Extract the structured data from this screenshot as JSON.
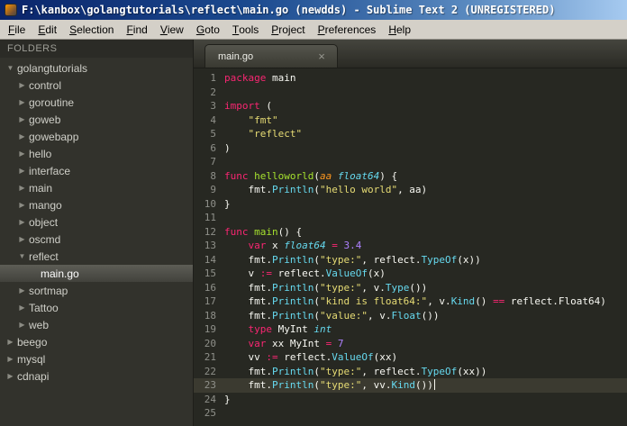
{
  "titlebar": {
    "title": "F:\\kanbox\\golangtutorials\\reflect\\main.go (newdds) - Sublime Text 2 (UNREGISTERED)"
  },
  "menubar": {
    "items": [
      "File",
      "Edit",
      "Selection",
      "Find",
      "View",
      "Goto",
      "Tools",
      "Project",
      "Preferences",
      "Help"
    ]
  },
  "icons": {
    "expanded": "▼",
    "collapsed": "▶",
    "close": "×"
  },
  "sidebar": {
    "header": "FOLDERS",
    "items": [
      {
        "label": "golangtutorials",
        "level": 0,
        "kind": "folder",
        "state": "expanded",
        "selected": false
      },
      {
        "label": "control",
        "level": 1,
        "kind": "folder",
        "state": "collapsed",
        "selected": false
      },
      {
        "label": "goroutine",
        "level": 1,
        "kind": "folder",
        "state": "collapsed",
        "selected": false
      },
      {
        "label": "goweb",
        "level": 1,
        "kind": "folder",
        "state": "collapsed",
        "selected": false
      },
      {
        "label": "gowebapp",
        "level": 1,
        "kind": "folder",
        "state": "collapsed",
        "selected": false
      },
      {
        "label": "hello",
        "level": 1,
        "kind": "folder",
        "state": "collapsed",
        "selected": false
      },
      {
        "label": "interface",
        "level": 1,
        "kind": "folder",
        "state": "collapsed",
        "selected": false
      },
      {
        "label": "main",
        "level": 1,
        "kind": "folder",
        "state": "collapsed",
        "selected": false
      },
      {
        "label": "mango",
        "level": 1,
        "kind": "folder",
        "state": "collapsed",
        "selected": false
      },
      {
        "label": "object",
        "level": 1,
        "kind": "folder",
        "state": "collapsed",
        "selected": false
      },
      {
        "label": "oscmd",
        "level": 1,
        "kind": "folder",
        "state": "collapsed",
        "selected": false
      },
      {
        "label": "reflect",
        "level": 1,
        "kind": "folder",
        "state": "expanded",
        "selected": false
      },
      {
        "label": "main.go",
        "level": 2,
        "kind": "file",
        "state": "none",
        "selected": true
      },
      {
        "label": "sortmap",
        "level": 1,
        "kind": "folder",
        "state": "collapsed",
        "selected": false
      },
      {
        "label": "Tattoo",
        "level": 1,
        "kind": "folder",
        "state": "collapsed",
        "selected": false
      },
      {
        "label": "web",
        "level": 1,
        "kind": "folder",
        "state": "collapsed",
        "selected": false
      },
      {
        "label": "beego",
        "level": 0,
        "kind": "folder",
        "state": "collapsed",
        "selected": false
      },
      {
        "label": "mysql",
        "level": 0,
        "kind": "folder",
        "state": "collapsed",
        "selected": false
      },
      {
        "label": "cdnapi",
        "level": 0,
        "kind": "folder",
        "state": "collapsed",
        "selected": false
      }
    ]
  },
  "editor": {
    "tab": {
      "label": "main.go"
    },
    "current_line": 23,
    "lines": [
      {
        "n": 1,
        "tokens": [
          [
            "k",
            "package"
          ],
          [
            "p",
            " main"
          ]
        ]
      },
      {
        "n": 2,
        "tokens": []
      },
      {
        "n": 3,
        "tokens": [
          [
            "k",
            "import"
          ],
          [
            "p",
            " ("
          ]
        ]
      },
      {
        "n": 4,
        "tokens": [
          [
            "p",
            "    "
          ],
          [
            "s",
            "\"fmt\""
          ]
        ]
      },
      {
        "n": 5,
        "tokens": [
          [
            "p",
            "    "
          ],
          [
            "s",
            "\"reflect\""
          ]
        ]
      },
      {
        "n": 6,
        "tokens": [
          [
            "p",
            ")"
          ]
        ]
      },
      {
        "n": 7,
        "tokens": []
      },
      {
        "n": 8,
        "tokens": [
          [
            "k",
            "func"
          ],
          [
            "p",
            " "
          ],
          [
            "fn",
            "helloworld"
          ],
          [
            "p",
            "("
          ],
          [
            "a",
            "aa"
          ],
          [
            "p",
            " "
          ],
          [
            "t",
            "float64"
          ],
          [
            "p",
            ") {"
          ]
        ]
      },
      {
        "n": 9,
        "tokens": [
          [
            "p",
            "    fmt."
          ],
          [
            "c",
            "Println"
          ],
          [
            "p",
            "("
          ],
          [
            "s",
            "\"hello world\""
          ],
          [
            "p",
            ", aa)"
          ]
        ]
      },
      {
        "n": 10,
        "tokens": [
          [
            "p",
            "}"
          ]
        ]
      },
      {
        "n": 11,
        "tokens": []
      },
      {
        "n": 12,
        "tokens": [
          [
            "k",
            "func"
          ],
          [
            "p",
            " "
          ],
          [
            "fn",
            "main"
          ],
          [
            "p",
            "() {"
          ]
        ]
      },
      {
        "n": 13,
        "tokens": [
          [
            "p",
            "    "
          ],
          [
            "k",
            "var"
          ],
          [
            "p",
            " x "
          ],
          [
            "t",
            "float64"
          ],
          [
            "p",
            " "
          ],
          [
            "o",
            "="
          ],
          [
            "p",
            " "
          ],
          [
            "n",
            "3.4"
          ]
        ]
      },
      {
        "n": 14,
        "tokens": [
          [
            "p",
            "    fmt."
          ],
          [
            "c",
            "Println"
          ],
          [
            "p",
            "("
          ],
          [
            "s",
            "\"type:\""
          ],
          [
            "p",
            ", reflect."
          ],
          [
            "c",
            "TypeOf"
          ],
          [
            "p",
            "(x))"
          ]
        ]
      },
      {
        "n": 15,
        "tokens": [
          [
            "p",
            "    v "
          ],
          [
            "o",
            ":="
          ],
          [
            "p",
            " reflect."
          ],
          [
            "c",
            "ValueOf"
          ],
          [
            "p",
            "(x)"
          ]
        ]
      },
      {
        "n": 16,
        "tokens": [
          [
            "p",
            "    fmt."
          ],
          [
            "c",
            "Println"
          ],
          [
            "p",
            "("
          ],
          [
            "s",
            "\"type:\""
          ],
          [
            "p",
            ", v."
          ],
          [
            "c",
            "Type"
          ],
          [
            "p",
            "())"
          ]
        ]
      },
      {
        "n": 17,
        "tokens": [
          [
            "p",
            "    fmt."
          ],
          [
            "c",
            "Println"
          ],
          [
            "p",
            "("
          ],
          [
            "s",
            "\"kind is float64:\""
          ],
          [
            "p",
            ", v."
          ],
          [
            "c",
            "Kind"
          ],
          [
            "p",
            "() "
          ],
          [
            "o",
            "=="
          ],
          [
            "p",
            " reflect.Float64)"
          ]
        ]
      },
      {
        "n": 18,
        "tokens": [
          [
            "p",
            "    fmt."
          ],
          [
            "c",
            "Println"
          ],
          [
            "p",
            "("
          ],
          [
            "s",
            "\"value:\""
          ],
          [
            "p",
            ", v."
          ],
          [
            "c",
            "Float"
          ],
          [
            "p",
            "())"
          ]
        ]
      },
      {
        "n": 19,
        "tokens": [
          [
            "p",
            "    "
          ],
          [
            "k",
            "type"
          ],
          [
            "p",
            " MyInt "
          ],
          [
            "t",
            "int"
          ]
        ]
      },
      {
        "n": 20,
        "tokens": [
          [
            "p",
            "    "
          ],
          [
            "k",
            "var"
          ],
          [
            "p",
            " xx MyInt "
          ],
          [
            "o",
            "="
          ],
          [
            "p",
            " "
          ],
          [
            "n",
            "7"
          ]
        ]
      },
      {
        "n": 21,
        "tokens": [
          [
            "p",
            "    vv "
          ],
          [
            "o",
            ":="
          ],
          [
            "p",
            " reflect."
          ],
          [
            "c",
            "ValueOf"
          ],
          [
            "p",
            "(xx)"
          ]
        ]
      },
      {
        "n": 22,
        "tokens": [
          [
            "p",
            "    fmt."
          ],
          [
            "c",
            "Println"
          ],
          [
            "p",
            "("
          ],
          [
            "s",
            "\"type:\""
          ],
          [
            "p",
            ", reflect."
          ],
          [
            "c",
            "TypeOf"
          ],
          [
            "p",
            "(xx))"
          ]
        ]
      },
      {
        "n": 23,
        "tokens": [
          [
            "p",
            "    fmt."
          ],
          [
            "c",
            "Println"
          ],
          [
            "p",
            "("
          ],
          [
            "s",
            "\"type:\""
          ],
          [
            "p",
            ", vv."
          ],
          [
            "c",
            "Kind"
          ],
          [
            "p",
            "())"
          ]
        ]
      },
      {
        "n": 24,
        "tokens": [
          [
            "p",
            "}"
          ]
        ]
      },
      {
        "n": 25,
        "tokens": []
      }
    ]
  }
}
